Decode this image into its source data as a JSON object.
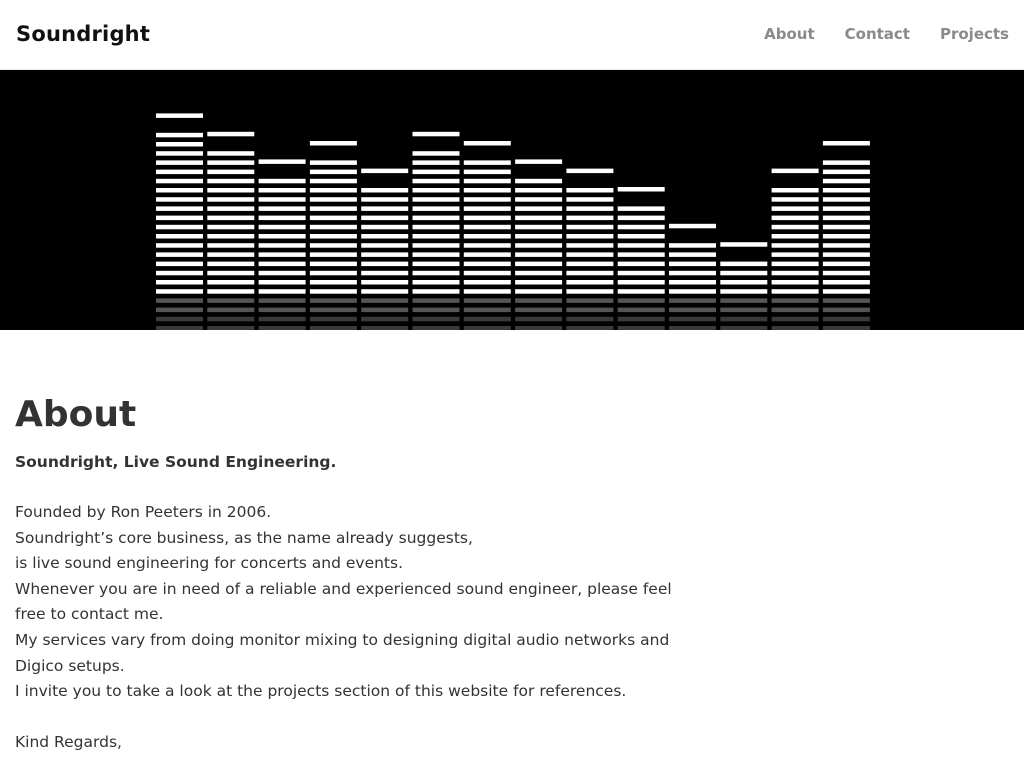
{
  "header": {
    "brand": "Soundright",
    "nav": [
      {
        "label": "About"
      },
      {
        "label": "Contact"
      },
      {
        "label": "Projects"
      }
    ]
  },
  "banner": {
    "image": "audio-equalizer-bars",
    "background": "#000000",
    "bar_color": "#ffffff",
    "levels": [
      18,
      16,
      13,
      15,
      12,
      16,
      15,
      13,
      12,
      10,
      6,
      4,
      12,
      15
    ],
    "max_level": 20
  },
  "about": {
    "title": "About",
    "lead": "Soundright, Live Sound Engineering.",
    "paragraphs": [
      "Founded by Ron Peeters in 2006.",
      "Soundright’s core business, as the name already suggests,",
      "is live sound engineering for concerts and events.",
      "Whenever you are in need of a reliable and experienced sound engineer, please feel free to contact me.",
      "My services vary from doing monitor mixing to designing digital audio networks and Digico setups.",
      "I invite you to take a look at the projects section of this website for references."
    ],
    "closing": "Kind Regards,"
  }
}
